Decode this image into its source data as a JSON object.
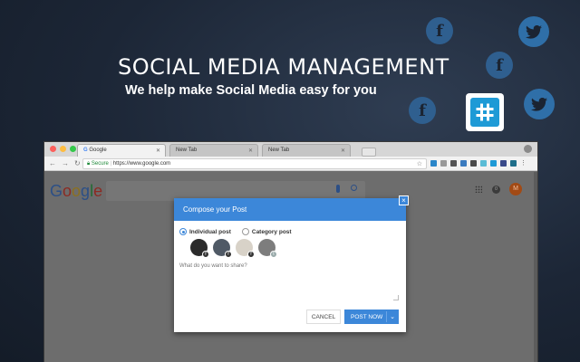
{
  "promo": {
    "headline": "SOCIAL MEDIA MANAGEMENT",
    "subline": "We help make Social Media easy for you"
  },
  "social_icons": [
    "facebook-icon",
    "twitter-icon",
    "hashtag-app-icon"
  ],
  "browser": {
    "tabs": [
      {
        "label": "Google",
        "active": true
      },
      {
        "label": "New Tab",
        "active": false
      },
      {
        "label": "New Tab",
        "active": false
      }
    ],
    "address": {
      "secure_label": "Secure",
      "url": "https://www.google.com"
    }
  },
  "google": {
    "logo": "Google",
    "avatar_letter": "M",
    "notification_count": "0"
  },
  "dialog": {
    "title": "Compose your Post",
    "close_glyph": "×",
    "radio_individual": "Individual post",
    "radio_category": "Category post",
    "share_placeholder": "What do you want to share?",
    "cancel_label": "CANCEL",
    "post_label": "POST NOW"
  },
  "colors": {
    "accent": "#3c87d9",
    "background": "#1c2636"
  }
}
